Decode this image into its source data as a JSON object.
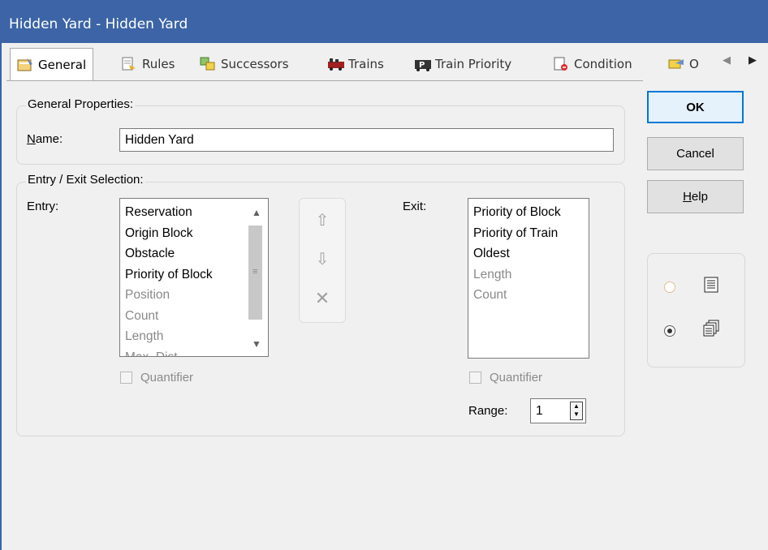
{
  "window": {
    "title": "Hidden Yard - Hidden Yard"
  },
  "tabs": [
    {
      "label": "General",
      "icon": "general-icon",
      "active": true
    },
    {
      "label": "Rules",
      "icon": "rules-icon"
    },
    {
      "label": "Successors",
      "icon": "successors-icon"
    },
    {
      "label": "Trains",
      "icon": "trains-icon"
    },
    {
      "label": "Train Priority",
      "icon": "train-priority-icon"
    },
    {
      "label": "Condition",
      "icon": "condition-icon"
    },
    {
      "label": "O",
      "icon": "options-icon"
    }
  ],
  "general": {
    "legend": "General Properties:",
    "name_label_first": "N",
    "name_label_rest": "ame:",
    "name_value": "Hidden Yard"
  },
  "entry_exit": {
    "legend": "Entry / Exit Selection:",
    "entry_label": "Entry:",
    "exit_label": "Exit:",
    "entry_items": [
      {
        "text": "Reservation",
        "enabled": true
      },
      {
        "text": "Origin Block",
        "enabled": true
      },
      {
        "text": "Obstacle",
        "enabled": true
      },
      {
        "text": "Priority of Block",
        "enabled": true
      },
      {
        "text": "Position",
        "enabled": false
      },
      {
        "text": "Count",
        "enabled": false
      },
      {
        "text": "Length",
        "enabled": false
      },
      {
        "text": "Max. Dist.",
        "enabled": false
      }
    ],
    "exit_items": [
      {
        "text": "Priority of Block",
        "enabled": true
      },
      {
        "text": "Priority of Train",
        "enabled": true
      },
      {
        "text": "Oldest",
        "enabled": true
      },
      {
        "text": "Length",
        "enabled": false
      },
      {
        "text": "Count",
        "enabled": false
      }
    ],
    "entry_quantifier": "Quantifier",
    "exit_quantifier": "Quantifier",
    "range_label": "Range:",
    "range_value": "1"
  },
  "buttons": {
    "ok": "OK",
    "cancel": "Cancel",
    "help_first": "H",
    "help_rest": "elp"
  },
  "view_options": {
    "list_icon": "list-view-icon",
    "detail_icon": "detail-view-icon",
    "selected": "detail"
  },
  "colors": {
    "titlebar": "#3c64a6",
    "accent": "#0078d7"
  }
}
